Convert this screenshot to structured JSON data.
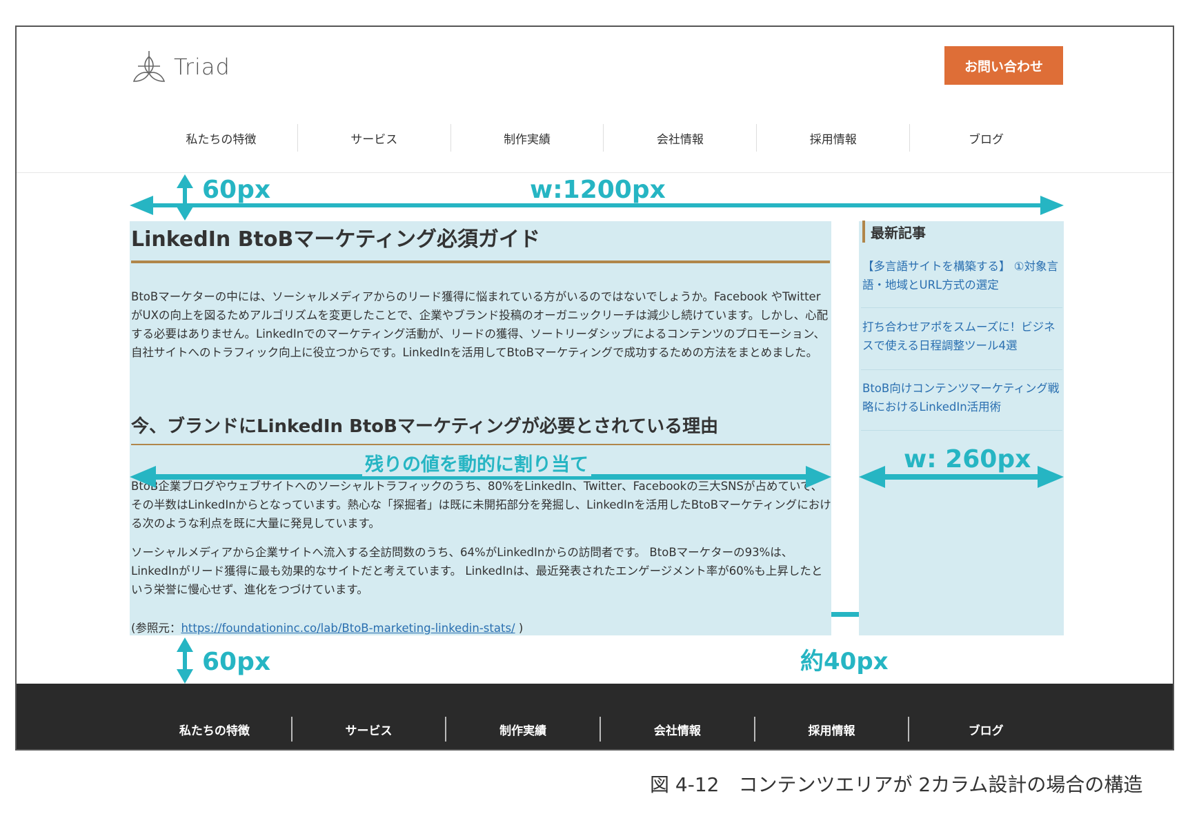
{
  "header": {
    "logo_text": "Triad",
    "cta_label": "お問い合わせ",
    "nav": [
      "私たちの特徴",
      "サービス",
      "制作実績",
      "会社情報",
      "採用情報",
      "ブログ"
    ]
  },
  "article": {
    "title": "LinkedIn BtoBマーケティング必須ガイド",
    "intro": "BtoBマーケターの中には、ソーシャルメディアからのリード獲得に悩まれている方がいるのではないでしょうか。Facebook やTwitterがUXの向上を図るためアルゴリズムを変更したことで、企業やブランド投稿のオーガニックリーチは減少し続けています。しかし、心配する必要はありません。LinkedInでのマーケティング活動が、リードの獲得、ソートリーダシップによるコンテンツのプロモーション、自社サイトへのトラフィック向上に役立つからです。LinkedInを活用してBtoBマーケティングで成功するための方法をまとめました。",
    "heading": "今、ブランドにLinkedIn BtoBマーケティングが必要とされている理由",
    "para2": "BtoB企業ブログやウェブサイトへのソーシャルトラフィックのうち、80%をLinkedIn、Twitter、Facebookの三大SNSが占めていて、その半数はLinkedInからとなっています。熱心な「探掘者」は既に未開拓部分を発掘し、LinkedInを活用したBtoBマーケティングにおける次のような利点を既に大量に発見しています。",
    "para3": "ソーシャルメディアから企業サイトへ流入する全訪問数のうち、64%がLinkedInからの訪問者です。 BtoBマーケターの93%は、LinkedInがリード獲得に最も効果的なサイトだと考えています。 LinkedInは、最近発表されたエンゲージメント率が60%も上昇したという栄誉に慢心せず、進化をつづけています。",
    "ref_prefix": "(参照元：",
    "ref_link": "https://foundationinc.co/lab/BtoB-marketing-linkedin-stats/",
    "ref_suffix": " )"
  },
  "sidebar": {
    "heading": "最新記事",
    "links": [
      "【多言語サイトを構築する】 ①対象言語・地域とURL方式の選定",
      "打ち合わせアポをスムーズに！ビジネスで使える日程調整ツール4選",
      "BtoB向けコンテンツマーケティング戦略におけるLinkedIn活用術"
    ]
  },
  "annotations": {
    "top_margin": "60px",
    "total_width": "w:1200px",
    "main_width": "残りの値を動的に割り当て",
    "side_width": "w: 260px",
    "gap": "約40px",
    "bottom_margin": "60px",
    "color": "#26b5c3"
  },
  "footer": {
    "nav": [
      "私たちの特徴",
      "サービス",
      "制作実績",
      "会社情報",
      "採用情報",
      "ブログ"
    ]
  },
  "caption": "図 4-12　コンテンツエリアが 2カラム設計の場合の構造",
  "colors": {
    "cta": "#de6e37",
    "column_bg": "#d5ebf1",
    "accent_rule": "#b0864a",
    "footer_bg": "#2a2a2a",
    "link": "#2a6fb0"
  }
}
